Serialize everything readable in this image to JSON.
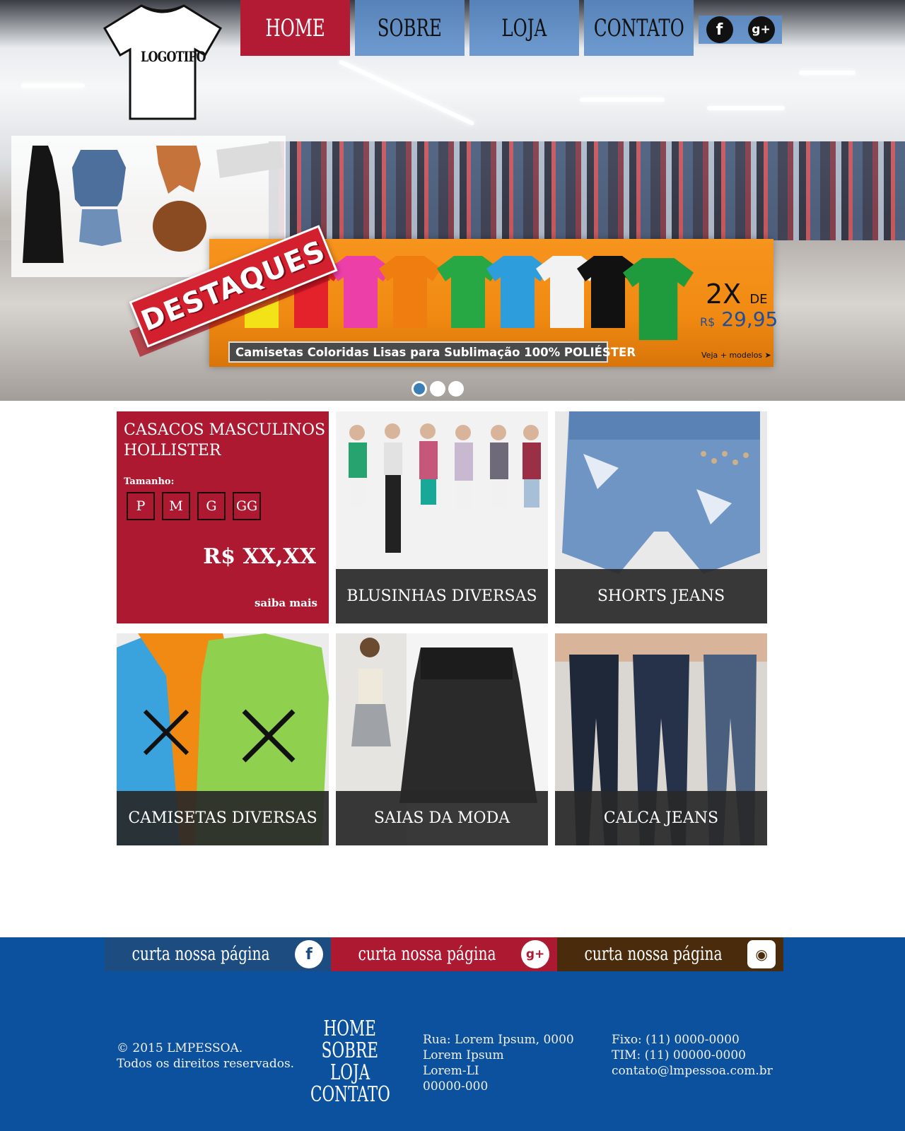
{
  "header": {
    "logo_text": "LOGOTIPO",
    "nav": [
      {
        "label": "HOME",
        "active": true
      },
      {
        "label": "SOBRE",
        "active": false
      },
      {
        "label": "LOJA",
        "active": false
      },
      {
        "label": "CONTATO",
        "active": false
      }
    ],
    "social_icons": [
      "facebook-icon",
      "google-plus-icon"
    ]
  },
  "hero": {
    "badge_text": "DESTAQUES",
    "promo_text": "Camisetas Coloridas Lisas para Sublimação 100% POLIÉSTER",
    "installments": "2X",
    "installments_suffix": "DE",
    "currency": "R$",
    "price": "29,95",
    "more_link": "Veja + modelos ➤",
    "slides": 3,
    "active_slide": 1
  },
  "featured": {
    "title": "CASACOS MASCULINOS HOLLISTER",
    "size_label": "Tamanho:",
    "sizes": [
      "P",
      "M",
      "G",
      "GG"
    ],
    "price": "R$ XX,XX",
    "more": "saiba mais"
  },
  "categories": [
    {
      "label": "BLUSINHAS DIVERSAS"
    },
    {
      "label": "SHORTS JEANS"
    },
    {
      "label": "CAMISETAS DIVERSAS"
    },
    {
      "label": "SAIAS DA MODA"
    },
    {
      "label": "CALCA JEANS"
    }
  ],
  "social_strip": [
    {
      "label": "curta nossa página",
      "icon": "facebook-icon",
      "color": "#1c4c80"
    },
    {
      "label": "curta nossa página",
      "icon": "google-plus-icon",
      "color": "#ae1932"
    },
    {
      "label": "curta nossa página",
      "icon": "instagram-icon",
      "color": "#4a2c0d"
    }
  ],
  "footer": {
    "copyright": [
      "© 2015 LMPESSOA.",
      "Todos os direitos reservados."
    ],
    "nav": [
      "HOME",
      "SOBRE",
      "LOJA",
      "CONTATO"
    ],
    "address": [
      "Rua: Lorem Ipsum, 0000",
      "Lorem Ipsum",
      "Lorem-LI",
      "00000-000"
    ],
    "contact": [
      "Fixo: (11) 0000-0000",
      "TIM: (11) 00000-0000",
      "contato@lmpessoa.com.br"
    ],
    "background": "#0b519d"
  },
  "colors": {
    "accent_red": "#ae1932",
    "nav_blue": "#5a8cc8",
    "banner_orange": "#f08a12"
  }
}
